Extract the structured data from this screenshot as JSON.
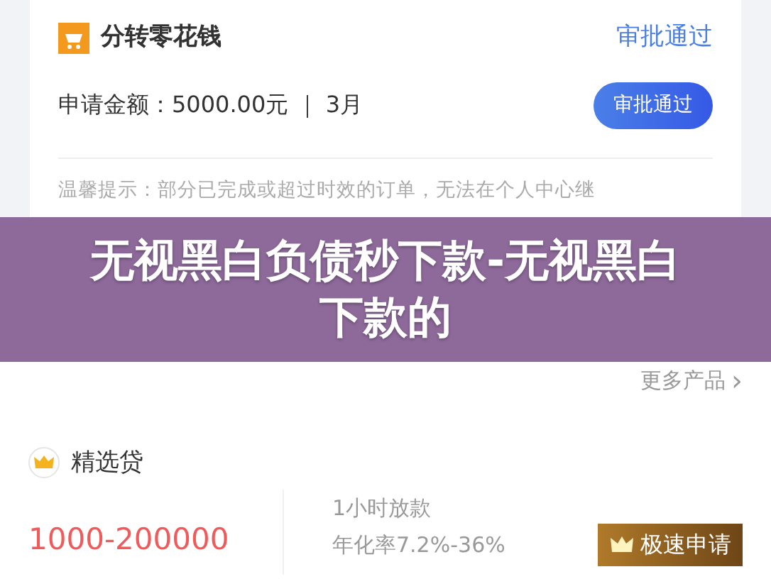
{
  "order": {
    "name": "分转零花钱",
    "status": "审批通过",
    "amount": "申请金额：5000.00元 ｜ 3月",
    "button": "审批通过"
  },
  "notice": "温馨提示：部分已完成或超过时效的订单，无法在个人中心继",
  "banner": {
    "title": "无视黑白负债秒下款-无视黑白下款的"
  },
  "more": {
    "label": "更多产品",
    "arrow": "›"
  },
  "product": {
    "name": "精选贷",
    "range": "1000-200000",
    "features": [
      "1小时放款",
      "年化率7.2%-36%"
    ],
    "button": "极速申请"
  }
}
